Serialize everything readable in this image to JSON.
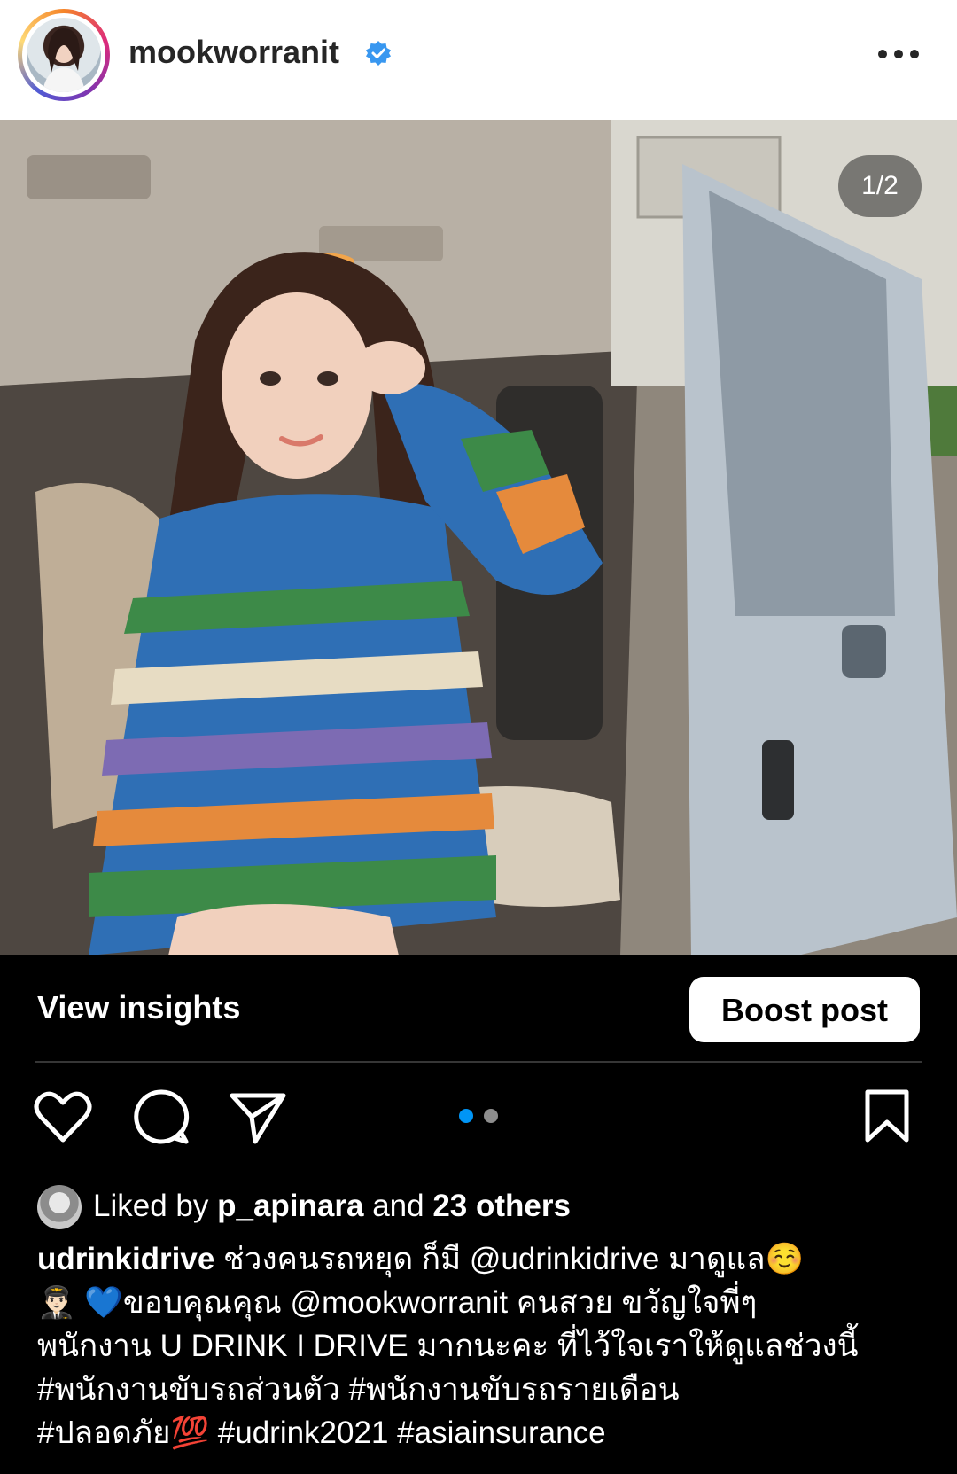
{
  "header": {
    "username": "mookworranit",
    "verified": true,
    "more_icon": "more-horizontal-icon"
  },
  "post": {
    "image_counter": "1/2",
    "image_description_colors": {
      "sweater": "#2f6fb5",
      "van": "#b9c3cc"
    }
  },
  "insights": {
    "view_insights_label": "View insights",
    "boost_label": "Boost post"
  },
  "actions": {
    "like_icon": "heart-icon",
    "comment_icon": "comment-icon",
    "share_icon": "share-icon",
    "save_icon": "bookmark-icon",
    "carousel": {
      "total": 2,
      "active": 1,
      "active_color": "#0095f6",
      "inactive_color": "#8e8e8e"
    }
  },
  "likes": {
    "prefix": "Liked by",
    "user": "p_apinara",
    "conjunction": "and",
    "others": "23 others"
  },
  "caption": {
    "author": "udrinkidrive",
    "line1_text": " ช่วงคนรถหยุด ก็มี @udrinkidrive มาดูแล☺️",
    "line2_text": "👨🏻‍✈️ 💙ขอบคุณคุณ @mookworranit คนสวย ขวัญใจพี่ๆ",
    "line3_text": "พนักงาน U DRINK I DRIVE มากนะคะ ที่ไว้ใจเราให้ดูแลช่วงนี้",
    "line4_text": "#พนักงานขับรถส่วนตัว #พนักงานขับรถรายเดือน",
    "line5_text": "#ปลอดภัย💯 #udrink2021 #asiainsurance"
  }
}
